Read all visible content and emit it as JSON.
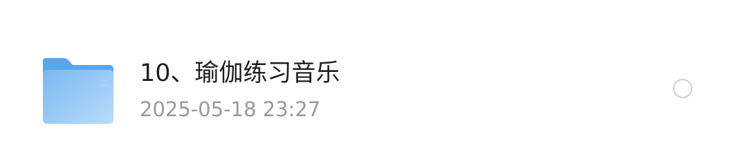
{
  "file_item": {
    "icon": "folder-icon",
    "name": "10、瑜伽练习音乐",
    "modified": "2025-05-18 23:27",
    "selected": false
  },
  "colors": {
    "folder_back": "#5aa8ee",
    "folder_front_start": "#7dbaf2",
    "folder_front_end": "#b6d9fb",
    "name_text": "#1f1f1f",
    "meta_text": "#9a9a9a",
    "radio_border": "#cfcfcf"
  }
}
